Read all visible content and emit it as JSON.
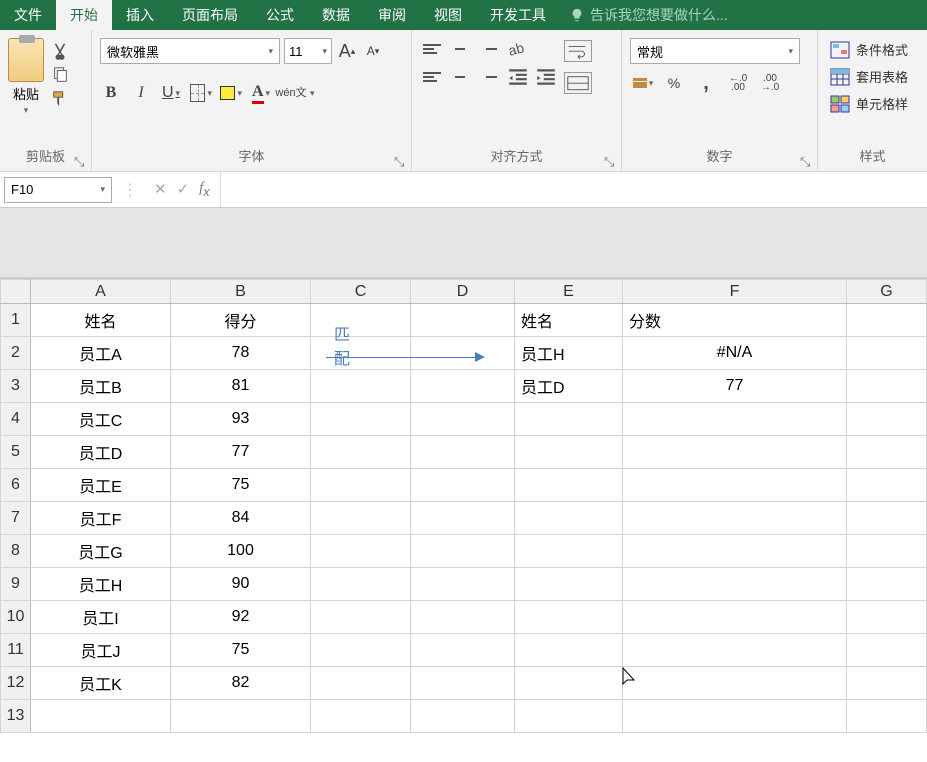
{
  "tabs": {
    "file": "文件",
    "home": "开始",
    "insert": "插入",
    "pagelayout": "页面布局",
    "formulas": "公式",
    "data": "数据",
    "review": "审阅",
    "view": "视图",
    "developer": "开发工具",
    "tellme": "告诉我您想要做什么..."
  },
  "ribbon": {
    "clipboard": {
      "paste": "粘贴",
      "label": "剪贴板"
    },
    "font": {
      "name": "微软雅黑",
      "size": "11",
      "label": "字体",
      "wen_top": "wén",
      "wen_bottom": "文",
      "bold": "B",
      "italic": "I",
      "underline": "U",
      "font_color_letter": "A",
      "increase_a": "A",
      "decrease_a": "A"
    },
    "alignment": {
      "label": "对齐方式"
    },
    "number": {
      "format": "常规",
      "label": "数字",
      "percent": "%",
      "comma": ",",
      "inc_dec": ".00",
      "dec_dec": ".0"
    },
    "styles": {
      "conditional": "条件格式",
      "table": "套用表格",
      "cell": "单元格样",
      "label": "样式"
    }
  },
  "formula_bar": {
    "name_box": "F10",
    "cancel": "✕",
    "enter": "✓",
    "formula": ""
  },
  "grid": {
    "cols": [
      "A",
      "B",
      "C",
      "D",
      "E",
      "F",
      "G"
    ],
    "rows_count": 13,
    "headers": {
      "a1": "姓名",
      "b1": "得分",
      "e1": "姓名",
      "f1": "分数"
    },
    "left_data": [
      {
        "name": "员工A",
        "score": "78"
      },
      {
        "name": "员工B",
        "score": "81"
      },
      {
        "name": "员工C",
        "score": "93"
      },
      {
        "name": "员工D",
        "score": "77"
      },
      {
        "name": "员工E",
        "score": "75"
      },
      {
        "name": "员工F",
        "score": "84"
      },
      {
        "name": "员工G",
        "score": "100"
      },
      {
        "name": "员工H",
        "score": "90"
      },
      {
        "name": "员工I",
        "score": "92"
      },
      {
        "name": "员工J",
        "score": "75"
      },
      {
        "name": "员工K",
        "score": "82"
      }
    ],
    "right_data": [
      {
        "name": "员工H",
        "score": "#N/A"
      },
      {
        "name": "员工D",
        "score": "77"
      }
    ],
    "annotation": "匹配"
  }
}
